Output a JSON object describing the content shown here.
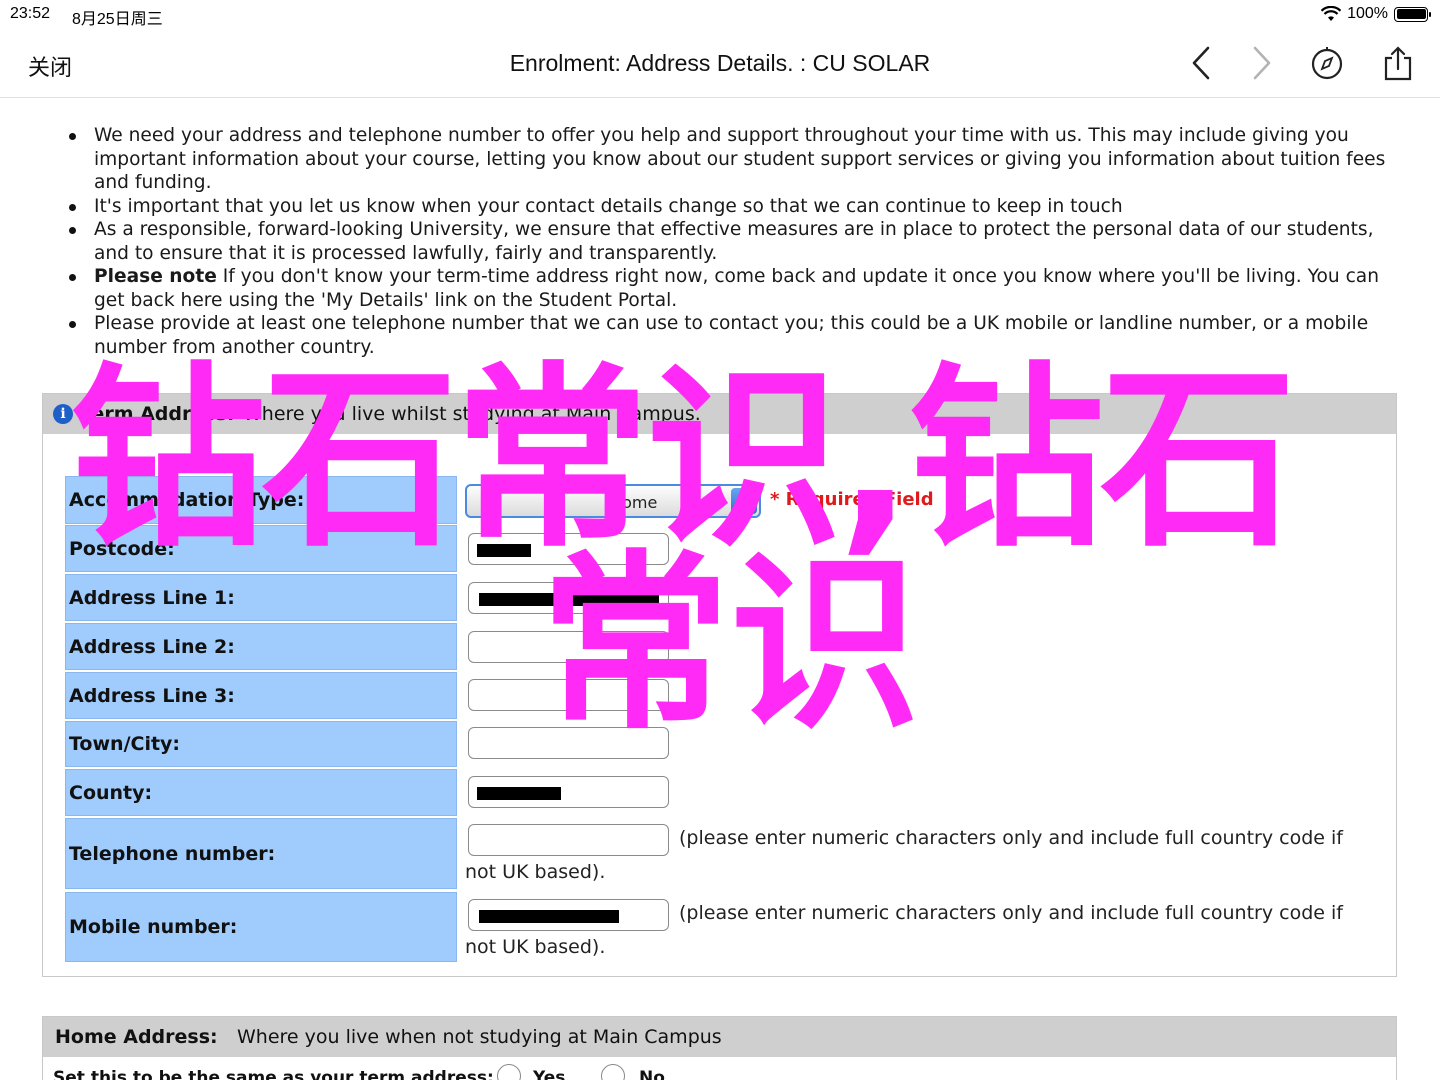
{
  "status_bar": {
    "time": "23:52",
    "date": "8月25日周三",
    "battery": "100%"
  },
  "nav": {
    "close_label": "关闭",
    "title": "Enrolment: Address Details. : CU SOLAR"
  },
  "intro_bullets": [
    "We need your address and telephone number to offer you help and support throughout your time with us. This may include giving you important information about your course, letting you know about our student support services or giving you information about tuition fees and funding.",
    "It's important that you let us know when your contact details change so that we can continue to keep in touch",
    "As a responsible, forward-looking University, we ensure that effective measures are in place to protect the personal data of our students, and to ensure that it is processed lawfully, fairly and transparently.",
    {
      "bold": "Please note",
      "text": " If you don't know your term-time address right now, come back and update it once you know where you'll be living. You can get back here using the 'My Details' link on the Student Portal."
    },
    "Please provide at least one telephone number that we can use to contact you; this could be a UK mobile or landline number, or a mobile number from another country."
  ],
  "term_address": {
    "title": "Term Address:",
    "description": "Where you live whilst studying at Main Campus.",
    "fields": {
      "accommodation_type": {
        "label": "Accommodation Type:",
        "value": "home",
        "required_note": "* Required Field"
      },
      "postcode": {
        "label": "Postcode:"
      },
      "address_line_1": {
        "label": "Address Line 1:"
      },
      "address_line_2": {
        "label": "Address Line 2:"
      },
      "address_line_3": {
        "label": "Address Line 3:"
      },
      "town_city": {
        "label": "Town/City:"
      },
      "county": {
        "label": "County:"
      },
      "telephone": {
        "label": "Telephone number:",
        "hint_line1": "(please enter numeric characters only and include full country code if",
        "hint_line2": "not UK based)."
      },
      "mobile": {
        "label": "Mobile number:",
        "hint_line1": "(please enter numeric characters only and include full country code if",
        "hint_line2": "not UK based)."
      }
    }
  },
  "home_address": {
    "title": "Home Address:",
    "description": "Where you live when not studying at Main Campus",
    "same_as_term_question": "Set this to be the same as your term address:",
    "yes_label": "Yes",
    "no_label": "No"
  },
  "watermark": {
    "line1": "钻石常识,钻石",
    "line2": "常识",
    "color": "#ff2af5"
  }
}
